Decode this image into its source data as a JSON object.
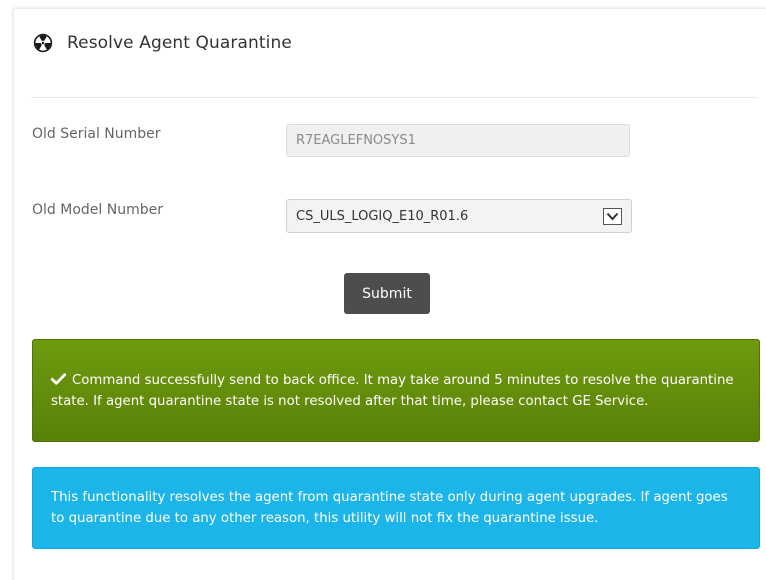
{
  "header": {
    "title": "Resolve Agent Quarantine",
    "icon": "radiation-icon"
  },
  "form": {
    "serial": {
      "label": "Old Serial Number",
      "value": "R7EAGLEFNOSYS1"
    },
    "model": {
      "label": "Old Model Number",
      "value": "CS_ULS_LOGIQ_E10_R01.6"
    },
    "submit_label": "Submit"
  },
  "alerts": {
    "success": {
      "icon": "checkmark-icon",
      "text": "Command successfully send to back office. It may take around 5 minutes to resolve the quarantine state. If agent quarantine state is not resolved after that time, please contact GE Service.",
      "color": "#669110"
    },
    "info": {
      "text": "This functionality resolves the agent from quarantine state only during agent upgrades. If agent goes to quarantine due to any other reason, this utility will not fix the quarantine issue.",
      "color": "#1bb5ea"
    }
  },
  "colors": {
    "submit_button": "#4d4d4d",
    "text": "#333333",
    "label": "#666666"
  }
}
